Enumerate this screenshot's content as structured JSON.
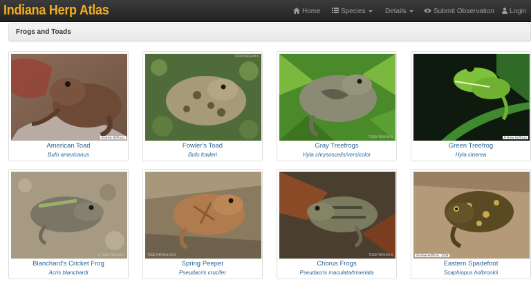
{
  "app": {
    "brand": "Indiana Herp Atlas"
  },
  "nav": {
    "home": "Home",
    "species": "Species",
    "details": "Details",
    "submit": "Submit Observation",
    "login": "Login"
  },
  "section": {
    "title": "Frogs and Toads"
  },
  "species": [
    {
      "common": "American Toad",
      "scientific": "Bufo americanus",
      "credit": "Andrew Hoffman"
    },
    {
      "common": "Fowler's Toad",
      "scientific": "Bufo fowleri",
      "credit": "TODD PIERSON ©"
    },
    {
      "common": "Gray Treefrogs",
      "scientific": "Hyla chrysoscelis/versicolor",
      "credit": "TODD PIERSON ©"
    },
    {
      "common": "Green Treefrog",
      "scientific": "Hyla cinerea",
      "credit": "Andrew Hoffman"
    },
    {
      "common": "Blanchard's Cricket Frog",
      "scientific": "Acris blanchardi",
      "credit": "© TODD PIERSON 2"
    },
    {
      "common": "Spring Peeper",
      "scientific": "Pseudacris crucifer",
      "credit": "TODD PIERSON 2010"
    },
    {
      "common": "Chorus Frogs",
      "scientific": "Pseudacris maculata/triseriata",
      "credit": "TODD PIERSON ©"
    },
    {
      "common": "Eastern Spadefoot",
      "scientific": "Scaphiopus holbrookii",
      "credit": "Andrew Hoffman, 2008"
    }
  ]
}
